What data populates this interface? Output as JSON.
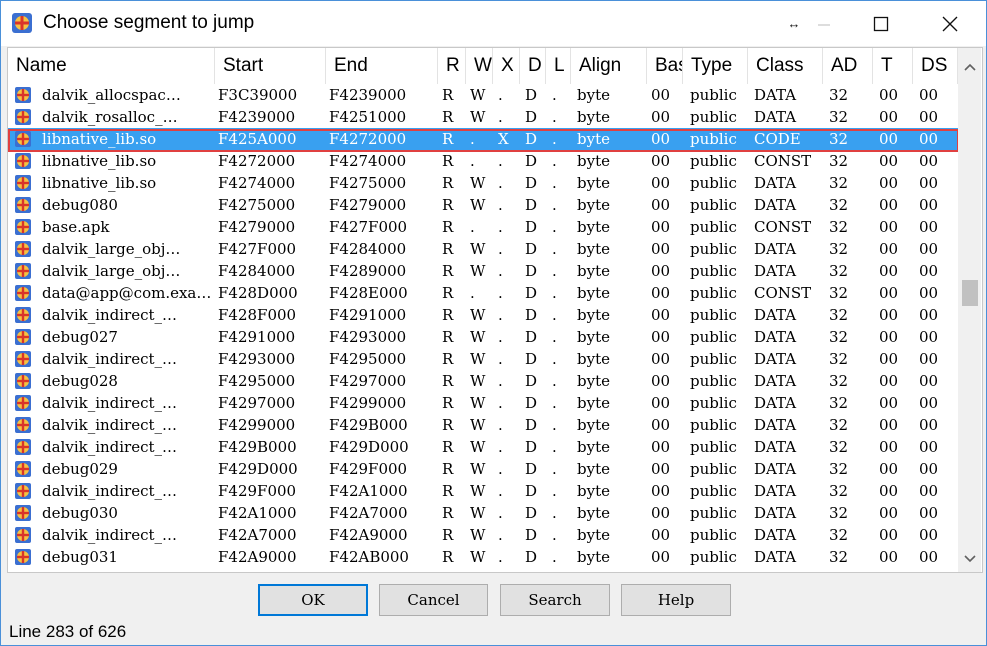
{
  "window": {
    "title": "Choose segment to jump",
    "restore_glyph": "↔",
    "controls": {
      "minimize": "—",
      "maximize": "□",
      "close": "✕"
    }
  },
  "table": {
    "columns": [
      "Name",
      "Start",
      "End",
      "R",
      "W",
      "X",
      "D",
      "L",
      "Align",
      "Bas",
      "Type",
      "Class",
      "AD",
      "T",
      "DS"
    ],
    "selected_index": 2,
    "rows": [
      [
        "dalvik_allocspac…",
        "F3C39000",
        "F4239000",
        "R",
        "W",
        ".",
        "D",
        ".",
        "byte",
        "00",
        "public",
        "DATA",
        "32",
        "00",
        "00"
      ],
      [
        "dalvik_rosalloc_…",
        "F4239000",
        "F4251000",
        "R",
        "W",
        ".",
        "D",
        ".",
        "byte",
        "00",
        "public",
        "DATA",
        "32",
        "00",
        "00"
      ],
      [
        "libnative_lib.so",
        "F425A000",
        "F4272000",
        "R",
        ".",
        "X",
        "D",
        ".",
        "byte",
        "00",
        "public",
        "CODE",
        "32",
        "00",
        "00"
      ],
      [
        "libnative_lib.so",
        "F4272000",
        "F4274000",
        "R",
        ".",
        ".",
        "D",
        ".",
        "byte",
        "00",
        "public",
        "CONST",
        "32",
        "00",
        "00"
      ],
      [
        "libnative_lib.so",
        "F4274000",
        "F4275000",
        "R",
        "W",
        ".",
        "D",
        ".",
        "byte",
        "00",
        "public",
        "DATA",
        "32",
        "00",
        "00"
      ],
      [
        "debug080",
        "F4275000",
        "F4279000",
        "R",
        "W",
        ".",
        "D",
        ".",
        "byte",
        "00",
        "public",
        "DATA",
        "32",
        "00",
        "00"
      ],
      [
        "base.apk",
        "F4279000",
        "F427F000",
        "R",
        ".",
        ".",
        "D",
        ".",
        "byte",
        "00",
        "public",
        "CONST",
        "32",
        "00",
        "00"
      ],
      [
        "dalvik_large_obj…",
        "F427F000",
        "F4284000",
        "R",
        "W",
        ".",
        "D",
        ".",
        "byte",
        "00",
        "public",
        "DATA",
        "32",
        "00",
        "00"
      ],
      [
        "dalvik_large_obj…",
        "F4284000",
        "F4289000",
        "R",
        "W",
        ".",
        "D",
        ".",
        "byte",
        "00",
        "public",
        "DATA",
        "32",
        "00",
        "00"
      ],
      [
        "data@app@com.exa…",
        "F428D000",
        "F428E000",
        "R",
        ".",
        ".",
        "D",
        ".",
        "byte",
        "00",
        "public",
        "CONST",
        "32",
        "00",
        "00"
      ],
      [
        "dalvik_indirect_…",
        "F428F000",
        "F4291000",
        "R",
        "W",
        ".",
        "D",
        ".",
        "byte",
        "00",
        "public",
        "DATA",
        "32",
        "00",
        "00"
      ],
      [
        "debug027",
        "F4291000",
        "F4293000",
        "R",
        "W",
        ".",
        "D",
        ".",
        "byte",
        "00",
        "public",
        "DATA",
        "32",
        "00",
        "00"
      ],
      [
        "dalvik_indirect_…",
        "F4293000",
        "F4295000",
        "R",
        "W",
        ".",
        "D",
        ".",
        "byte",
        "00",
        "public",
        "DATA",
        "32",
        "00",
        "00"
      ],
      [
        "debug028",
        "F4295000",
        "F4297000",
        "R",
        "W",
        ".",
        "D",
        ".",
        "byte",
        "00",
        "public",
        "DATA",
        "32",
        "00",
        "00"
      ],
      [
        "dalvik_indirect_…",
        "F4297000",
        "F4299000",
        "R",
        "W",
        ".",
        "D",
        ".",
        "byte",
        "00",
        "public",
        "DATA",
        "32",
        "00",
        "00"
      ],
      [
        "dalvik_indirect_…",
        "F4299000",
        "F429B000",
        "R",
        "W",
        ".",
        "D",
        ".",
        "byte",
        "00",
        "public",
        "DATA",
        "32",
        "00",
        "00"
      ],
      [
        "dalvik_indirect_…",
        "F429B000",
        "F429D000",
        "R",
        "W",
        ".",
        "D",
        ".",
        "byte",
        "00",
        "public",
        "DATA",
        "32",
        "00",
        "00"
      ],
      [
        "debug029",
        "F429D000",
        "F429F000",
        "R",
        "W",
        ".",
        "D",
        ".",
        "byte",
        "00",
        "public",
        "DATA",
        "32",
        "00",
        "00"
      ],
      [
        "dalvik_indirect_…",
        "F429F000",
        "F42A1000",
        "R",
        "W",
        ".",
        "D",
        ".",
        "byte",
        "00",
        "public",
        "DATA",
        "32",
        "00",
        "00"
      ],
      [
        "debug030",
        "F42A1000",
        "F42A7000",
        "R",
        "W",
        ".",
        "D",
        ".",
        "byte",
        "00",
        "public",
        "DATA",
        "32",
        "00",
        "00"
      ],
      [
        "dalvik_indirect_…",
        "F42A7000",
        "F42A9000",
        "R",
        "W",
        ".",
        "D",
        ".",
        "byte",
        "00",
        "public",
        "DATA",
        "32",
        "00",
        "00"
      ],
      [
        "debug031",
        "F42A9000",
        "F42AB000",
        "R",
        "W",
        ".",
        "D",
        ".",
        "byte",
        "00",
        "public",
        "DATA",
        "32",
        "00",
        "00"
      ]
    ]
  },
  "buttons": {
    "ok": "OK",
    "cancel": "Cancel",
    "search": "Search",
    "help": "Help"
  },
  "status": "Line 283 of 626",
  "colors": {
    "selection": "#39a0f0",
    "highlight_border": "#e04040",
    "default_button_border": "#0078d7"
  },
  "icons": {
    "segment": "segment-icon",
    "app": "app-icon"
  }
}
